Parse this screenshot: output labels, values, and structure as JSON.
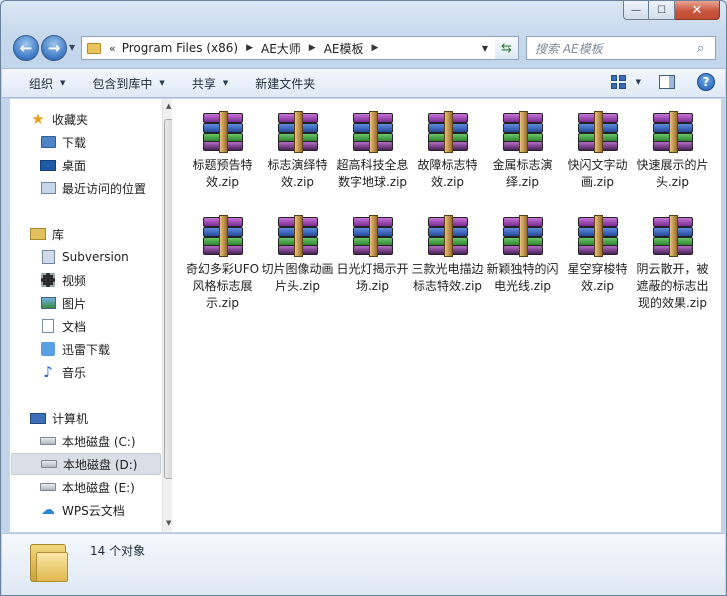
{
  "window": {
    "caption": {
      "minimize": "—",
      "maximize": "☐",
      "close": "✕"
    }
  },
  "address": {
    "chevron": "«",
    "crumbs": [
      "Program Files (x86)",
      "AE大师",
      "AE模板"
    ],
    "separator": "▶"
  },
  "search": {
    "placeholder": "搜索 AE模板",
    "icon": "search-icon"
  },
  "toolbar": {
    "organize": "组织",
    "include_in_library": "包含到库中",
    "share": "共享",
    "new_folder": "新建文件夹"
  },
  "navpane": {
    "favorites": "收藏夹",
    "downloads": "下载",
    "desktop": "桌面",
    "recent": "最近访问的位置",
    "libraries": "库",
    "subversion": "Subversion",
    "videos": "视频",
    "pictures": "图片",
    "documents": "文档",
    "thunder": "迅雷下载",
    "music": "音乐",
    "computer": "计算机",
    "drive_c": "本地磁盘 (C:)",
    "drive_d": "本地磁盘 (D:)",
    "drive_e": "本地磁盘 (E:)",
    "wps": "WPS云文档"
  },
  "files": [
    "标题预告特效.zip",
    "标志演绎特效.zip",
    "超高科技全息数字地球.zip",
    "故障标志特效.zip",
    "金属标志演绎.zip",
    "快闪文字动画.zip",
    "快速展示的片头.zip",
    "奇幻多彩UFO风格标志展示.zip",
    "切片图像动画片头.zip",
    "日光灯揭示开场.zip",
    "三款光电描边标志特效.zip",
    "新颖独特的闪电光线.zip",
    "星空穿梭特效.zip",
    "阴云散开，被遮蔽的标志出现的效果.zip"
  ],
  "status": {
    "count": "14 个对象"
  },
  "colors": {
    "accent": "#3b78c4",
    "selected_nav": "#d9dfe6"
  }
}
